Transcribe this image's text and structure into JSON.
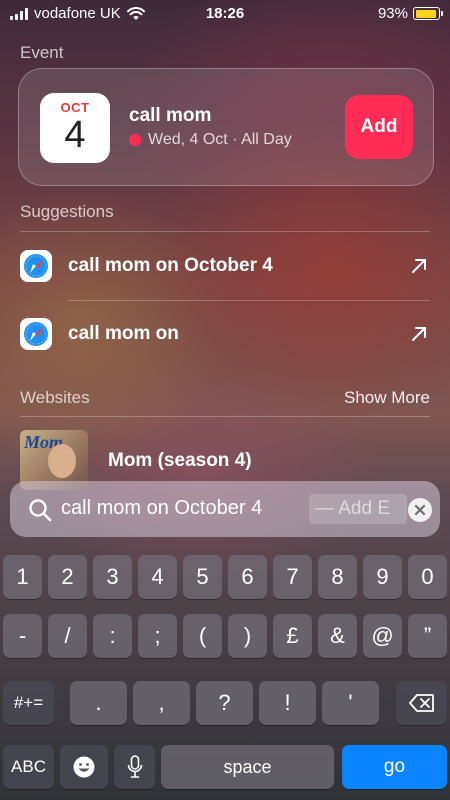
{
  "status_bar": {
    "carrier": "vodafone UK",
    "time": "18:26",
    "battery": "93%"
  },
  "event": {
    "section_title": "Event",
    "month": "OCT",
    "day": "4",
    "title": "call mom",
    "subtitle": "Wed, 4 Oct · All Day",
    "add_label": "Add",
    "accent_color": "#ff2d55"
  },
  "suggestions": {
    "section_title": "Suggestions",
    "items": [
      {
        "label": "call mom on October 4",
        "icon": "safari-icon"
      },
      {
        "label": "call mom on",
        "icon": "safari-icon"
      }
    ]
  },
  "websites": {
    "section_title": "Websites",
    "show_more": "Show More",
    "items": [
      {
        "title": "Mom (season 4)",
        "thumb_logo": "Mom"
      }
    ]
  },
  "search": {
    "query": "call mom on October 4",
    "completion": "— Add E"
  },
  "keyboard": {
    "row1": [
      "1",
      "2",
      "3",
      "4",
      "5",
      "6",
      "7",
      "8",
      "9",
      "0"
    ],
    "row2": [
      "-",
      "/",
      ":",
      ";",
      "(",
      ")",
      "£",
      "&",
      "@",
      "”"
    ],
    "row3": [
      ".",
      ",",
      "?",
      "!",
      "'"
    ],
    "symbols_label": "#+=",
    "abc_label": "ABC",
    "space_label": "space",
    "go_label": "go",
    "go_color": "#0a84ff"
  }
}
